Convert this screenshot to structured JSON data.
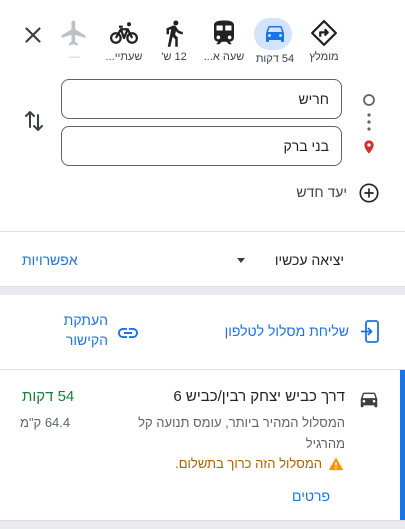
{
  "travel_modes": [
    {
      "id": "best",
      "label": "מומלץ",
      "icon": "diamond-turn-icon"
    },
    {
      "id": "drive",
      "label": "54 דקות",
      "icon": "car-icon",
      "active": true
    },
    {
      "id": "transit",
      "label": "שעה א...",
      "icon": "train-icon"
    },
    {
      "id": "walk",
      "label": "12 ש'",
      "icon": "walk-icon"
    },
    {
      "id": "bike",
      "label": "שעתיי...",
      "icon": "bike-icon"
    },
    {
      "id": "flight",
      "label": "—",
      "icon": "airplane-icon"
    }
  ],
  "origin": "חריש",
  "destination": "בני ברק",
  "add_destination_label": "יעד חדש",
  "depart_label": "יציאה עכשיו",
  "options_label": "אפשרויות",
  "send_to_phone_label": "שליחת מסלול לטלפון",
  "copy_link_label_line1": "העתקת",
  "copy_link_label_line2": "הקישור",
  "route": {
    "title": "דרך כביש יצחק רבין/כביש 6",
    "duration": "54 דקות",
    "distance": "64.4 ק\"מ",
    "desc_line1": "המסלול המהיר ביותר, עומס תנועה קל",
    "desc_line2": "מהרגיל",
    "warning": "המסלול הזה כרוך בתשלום.",
    "details_label": "פרטים"
  },
  "colors": {
    "accent": "#1a73e8",
    "active_bg": "#d2e3fc",
    "duration_green": "#188038",
    "warning": "#b06000",
    "warning_icon": "#f29900",
    "destination_pin": "#d93025"
  }
}
